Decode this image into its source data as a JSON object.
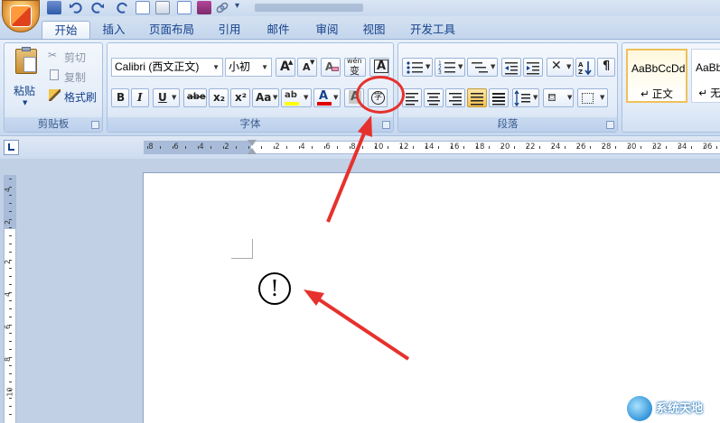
{
  "quick_access": {
    "more": "▾"
  },
  "tabs": [
    {
      "label": "开始",
      "active": true
    },
    {
      "label": "插入"
    },
    {
      "label": "页面布局"
    },
    {
      "label": "引用"
    },
    {
      "label": "邮件"
    },
    {
      "label": "审阅"
    },
    {
      "label": "视图"
    },
    {
      "label": "开发工具"
    }
  ],
  "clipboard": {
    "paste": "粘贴",
    "cut": "剪切",
    "copy": "复制",
    "format_painter": "格式刷",
    "group": "剪贴板"
  },
  "font": {
    "name": "Calibri (西文正文)",
    "size": "小初",
    "grow": "A",
    "shrink": "A",
    "clear": "A",
    "phonetic_top": "wén",
    "phonetic": "变",
    "border": "A",
    "bold": "B",
    "italic": "I",
    "underline": "U",
    "strike": "abe",
    "subscript": "x₂",
    "superscript": "x²",
    "change_case": "Aa",
    "highlight": "ab ",
    "color": "A",
    "shading": "A",
    "enclose": "字",
    "group": "字体"
  },
  "paragraph": {
    "group": "段落"
  },
  "styles": [
    {
      "sample": "AaBbCcDd",
      "name": "↵ 正文"
    },
    {
      "sample": "AaBbC",
      "name": "↵ 无"
    }
  ],
  "ruler": {
    "left_numbers": [
      "8",
      "6",
      "4",
      "2"
    ],
    "right_numbers": [
      "2",
      "4",
      "6",
      "8",
      "10",
      "12",
      "14",
      "16",
      "18",
      "20",
      "22",
      "24",
      "26",
      "28",
      "30",
      "32",
      "34",
      "36",
      "38"
    ],
    "vertical_numbers": [
      "4",
      "2",
      "2",
      "4",
      "6",
      "8",
      "10"
    ]
  },
  "document": {
    "enclosed_char": "!"
  },
  "colors": {
    "annotation": "#e6312d",
    "ribbon_text": "#15428b",
    "highlight_yellow": "#ffff00",
    "font_red": "#e00000"
  },
  "watermark": {
    "text": "系统天地"
  }
}
